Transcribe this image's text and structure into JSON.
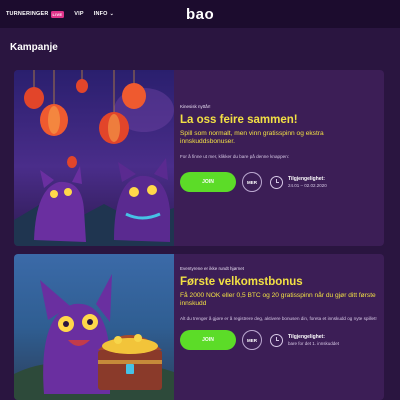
{
  "topbar": {
    "nav": [
      {
        "label": "TURNERINGER",
        "badge": "LIVE"
      },
      {
        "label": "VIP"
      },
      {
        "label": "INFO",
        "chevron": "chevron-down-icon"
      }
    ],
    "logo": "bao"
  },
  "page": {
    "title": "Kampanje"
  },
  "cards": [
    {
      "eyebrow": "Kinesisk nyttår!",
      "headline": "La oss feire sammen!",
      "description": "Spill som normalt, men vinn gratisspinn og ekstra innskuddsbonuser.",
      "small": "For å finne ut mer, klikker du bare på denne knappen:",
      "join_label": "JOIN",
      "more_label": "MER",
      "availability_label": "Tilgjengelighet:",
      "availability_value": "24.01 – 02.02.2020",
      "art": "chinese-lanterns-cats"
    },
    {
      "eyebrow": "Eventyrene er ikke rundt hjørnet",
      "headline": "Første velkomstbonus",
      "description": "Få 2000 NOK eller 0,5 BTC og 20 gratisspinn når du gjør ditt første innskudd",
      "small": "Alt du trenger å gjøre er å registrere deg, aktivere bonusen din, foreta et innskudd og nyte spillet!",
      "join_label": "JOIN",
      "more_label": "MER",
      "availability_label": "Tilgjengelighet:",
      "availability_value": "bare for det 1. innskuddet",
      "art": "cat-treasure-chest"
    }
  ],
  "colors": {
    "background": "#2a1540",
    "topbar": "#1c0c2e",
    "card": "#3c1e56",
    "accent_yellow": "#f2e044",
    "join_green": "#5cdc28",
    "live_badge": "#e0338a"
  }
}
